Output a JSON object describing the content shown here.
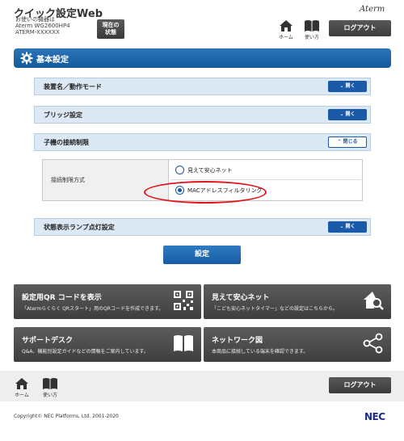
{
  "header": {
    "title": "クイック設定Web",
    "device_line1": "お使いの機器は",
    "device_line2": "Aterm WG2600HP4",
    "device_line3": "ATERM-XXXXXX",
    "status_button_line1": "現在の",
    "status_button_line2": "状態",
    "brand": "Aterm",
    "home_label": "ホーム",
    "help_label": "使い方",
    "logout_label": "ログアウト"
  },
  "section": {
    "title": "基本設定"
  },
  "accordion": [
    {
      "label": "装置名／動作モード",
      "button": "開く",
      "state": "collapsed"
    },
    {
      "label": "ブリッジ設定",
      "button": "開く",
      "state": "collapsed"
    },
    {
      "label": "子機の接続制限",
      "button": "閉じる",
      "state": "expanded"
    },
    {
      "label": "状態表示ランプ点灯設定",
      "button": "開く",
      "state": "collapsed"
    }
  ],
  "connection_limit": {
    "field_label": "接続制限方式",
    "options": [
      {
        "label": "見えて安心ネット",
        "checked": false
      },
      {
        "label": "MACアドレスフィルタリング",
        "checked": true
      }
    ]
  },
  "apply_button": "設定",
  "tiles": [
    {
      "title": "設定用QR コードを表示",
      "desc": "「Atermらくらく QRスタート」用のQRコードを作成できます。",
      "icon": "qr-code-icon"
    },
    {
      "title": "見えて安心ネット",
      "desc": "「こども安心ネットタイマー」などの設定はこちらから。",
      "icon": "house-magnifier-icon"
    },
    {
      "title": "サポートデスク",
      "desc": "Q&A、機能別設定ガイドなどの情報をご案内しています。",
      "icon": "book-icon"
    },
    {
      "title": "ネットワーク図",
      "desc": "本商品に接続している端末を確認できます。",
      "icon": "network-share-icon"
    }
  ],
  "footer": {
    "home_label": "ホーム",
    "help_label": "使い方",
    "logout_label": "ログアウト",
    "copyright": "Copyright© NEC Platforms, Ltd. 2001-2020",
    "logo": "NEC"
  },
  "colors": {
    "accent_blue": "#1a5aa8",
    "tile_dark": "#4a4a4a",
    "highlight_red": "#e3121b"
  }
}
